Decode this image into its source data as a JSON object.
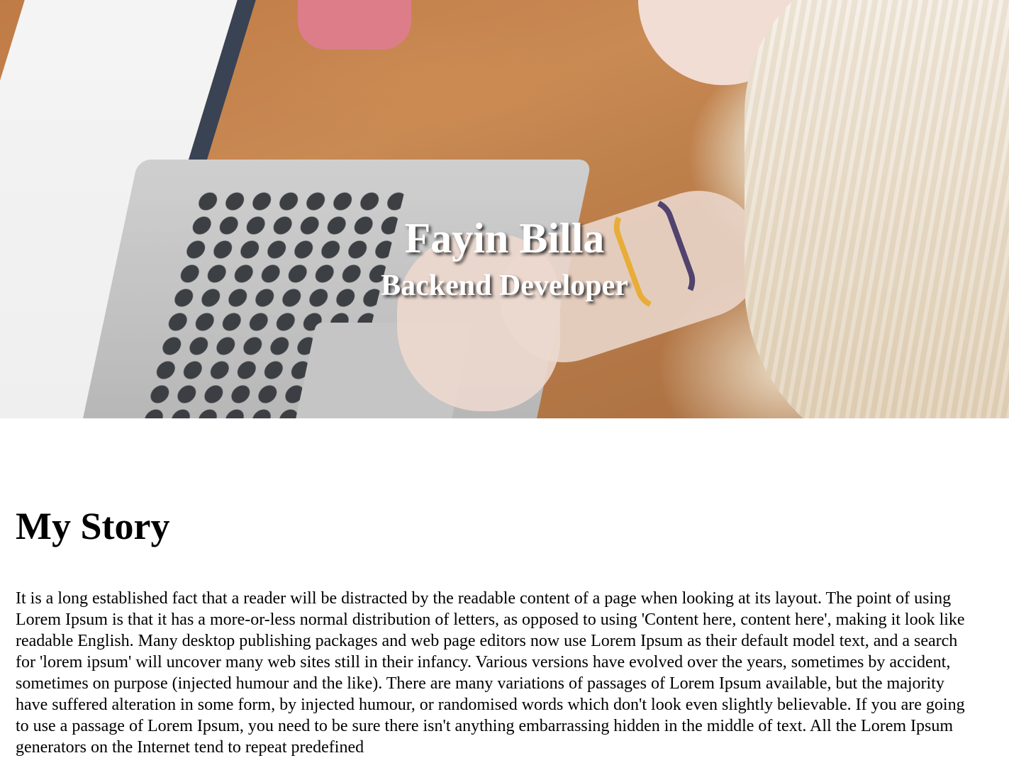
{
  "hero": {
    "name": "Fayin Billa",
    "role": "Backend Developer"
  },
  "story": {
    "heading": "My Story",
    "body": "It is a long established fact that a reader will be distracted by the readable content of a page when looking at its layout. The point of using Lorem Ipsum is that it has a more-or-less normal distribution of letters, as opposed to using 'Content here, content here', making it look like readable English. Many desktop publishing packages and web page editors now use Lorem Ipsum as their default model text, and a search for 'lorem ipsum' will uncover many web sites still in their infancy. Various versions have evolved over the years, sometimes by accident, sometimes on purpose (injected humour and the like). There are many variations of passages of Lorem Ipsum available, but the majority have suffered alteration in some form, by injected humour, or randomised words which don't look even slightly believable. If you are going to use a passage of Lorem Ipsum, you need to be sure there isn't anything embarrassing hidden in the middle of text. All the Lorem Ipsum generators on the Internet tend to repeat predefined"
  }
}
